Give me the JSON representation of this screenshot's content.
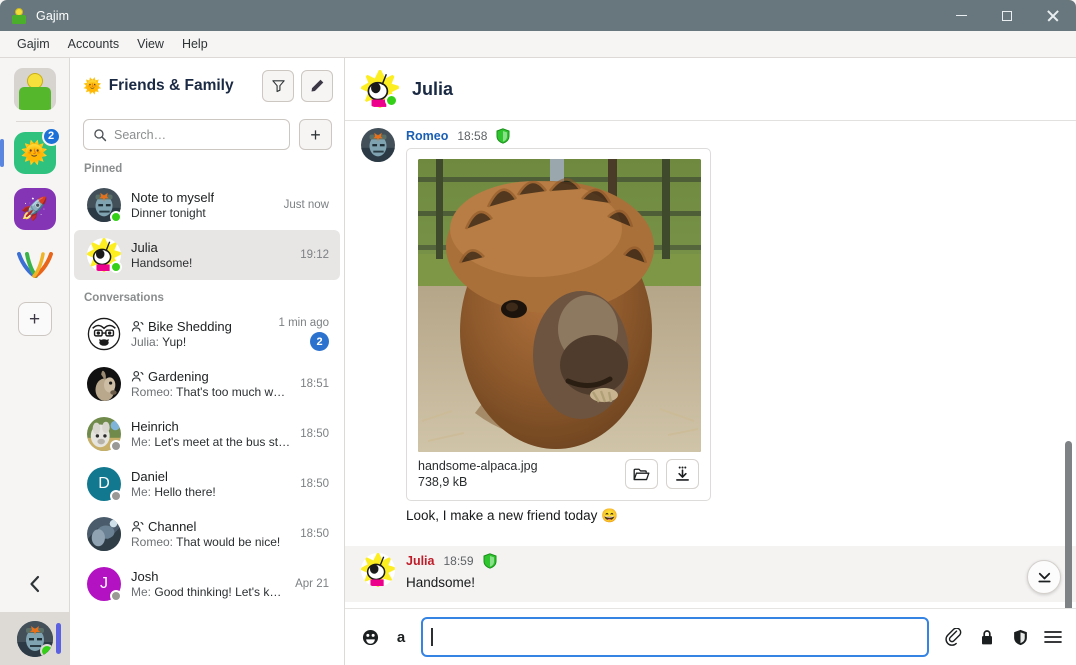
{
  "window": {
    "title": "Gajim",
    "app_icon": "gajim-logo-icon",
    "minimize_label": "Minimize",
    "maximize_label": "Maximize",
    "close_label": "Close"
  },
  "menubar": {
    "items": [
      {
        "label": "Gajim"
      },
      {
        "label": "Accounts"
      },
      {
        "label": "View"
      },
      {
        "label": "Help"
      }
    ]
  },
  "rail": {
    "account_avatar_name": "account-avatar",
    "accounts": [
      {
        "name": "sun-account",
        "emoji": "🌞",
        "badge": "2",
        "selected": true
      },
      {
        "name": "rocket-account",
        "emoji": "🚀",
        "badge": "",
        "selected": false
      }
    ],
    "logo_name": "gajim-v-logo",
    "add_account_label": "+",
    "collapse_label": "‹",
    "user_status": "online"
  },
  "chatlist": {
    "title": "Friends & Family",
    "title_emoji": "🌞",
    "filter_label": "Filter",
    "edit_label": "Edit",
    "search": {
      "placeholder": "Search…",
      "value": ""
    },
    "add_label": "+",
    "sections": [
      {
        "label": "Pinned",
        "rows": [
          {
            "name": "Note to myself",
            "preview_who": "",
            "preview": "Dinner tonight",
            "time": "Just now",
            "badge": "",
            "group": false,
            "presence": "online",
            "avatar_kind": "photo-romeo",
            "active": false
          },
          {
            "name": "Julia",
            "preview_who": "",
            "preview": "Handsome!",
            "time": "19:12",
            "badge": "",
            "group": false,
            "presence": "online",
            "avatar_kind": "julia",
            "active": true
          }
        ]
      },
      {
        "label": "Conversations",
        "rows": [
          {
            "name": "Bike Shedding",
            "preview_who": "Julia:",
            "preview": "Yup!",
            "time": "1 min ago",
            "badge": "2",
            "group": true,
            "presence": "",
            "avatar_kind": "bike",
            "active": false
          },
          {
            "name": "Gardening",
            "preview_who": "Romeo:",
            "preview": "That's too much water tho…",
            "time": "18:51",
            "badge": "",
            "group": true,
            "presence": "",
            "avatar_kind": "alpaca",
            "active": false
          },
          {
            "name": "Heinrich",
            "preview_who": "Me:",
            "preview": "Let's meet at the bus stop then",
            "time": "18:50",
            "badge": "",
            "group": false,
            "presence": "away",
            "avatar_kind": "heinrich",
            "active": false
          },
          {
            "name": "Daniel",
            "preview_who": "Me:",
            "preview": "Hello there!",
            "time": "18:50",
            "badge": "",
            "group": false,
            "presence": "away",
            "avatar_kind": "letter-D",
            "active": false
          },
          {
            "name": "Channel",
            "preview_who": "Romeo:",
            "preview": "That would be nice!",
            "time": "18:50",
            "badge": "",
            "group": true,
            "presence": "",
            "avatar_kind": "channel",
            "active": false
          },
          {
            "name": "Josh",
            "preview_who": "Me:",
            "preview": "Good thinking! Let's keep it then",
            "time": "Apr 21",
            "badge": "",
            "group": false,
            "presence": "away",
            "avatar_kind": "letter-J",
            "active": false
          }
        ]
      }
    ]
  },
  "chat": {
    "header": {
      "name": "Julia",
      "presence": "online",
      "avatar_kind": "julia"
    },
    "messages": [
      {
        "author": "Romeo",
        "author_color_class": "romeo",
        "time": "18:58",
        "encrypted": true,
        "avatar_kind": "photo-romeo",
        "attachment": {
          "filename": "handsome-alpaca.jpg",
          "filesize": "738,9 kB",
          "open_folder_label": "Open folder",
          "download_label": "Download",
          "alt": "brown alpaca portrait"
        },
        "text": "",
        "highlighted": false
      },
      {
        "author": "",
        "author_color_class": "romeo",
        "time": "",
        "encrypted": false,
        "avatar_kind": "",
        "text": "Look, I make a new friend today 😄",
        "highlighted": false
      },
      {
        "author": "Julia",
        "author_color_class": "julia",
        "time": "18:59",
        "encrypted": true,
        "avatar_kind": "julia",
        "text": "Handsome!",
        "highlighted": true
      }
    ],
    "scroll_down_label": "Scroll to bottom"
  },
  "compose": {
    "emoji_label": "Emoji",
    "format_label": "a",
    "input_placeholder": "",
    "input_value": "",
    "attach_label": "Attach file",
    "encryption_label": "Encryption",
    "security_label": "Security",
    "menu_label": "More options"
  },
  "colors": {
    "titlebar": "#68777d",
    "accent_blue": "#3584e4",
    "badge_blue": "#2b72cf",
    "author_romeo": "#1a5fb4",
    "author_julia": "#c01c28",
    "encryption_green": "#2ec52e",
    "presence_online": "#33d017",
    "presence_away": "#9a9996"
  }
}
